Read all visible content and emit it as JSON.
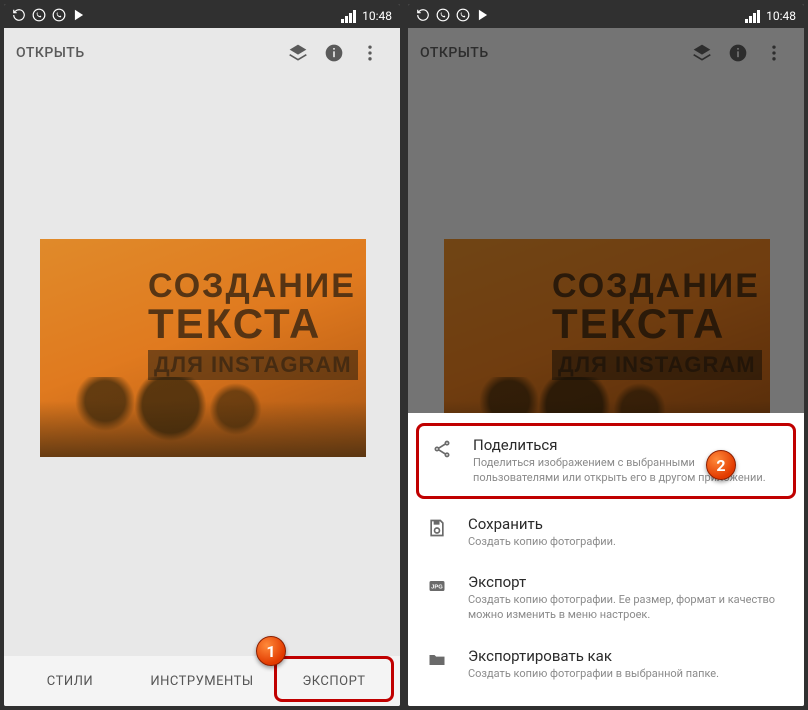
{
  "status": {
    "time": "10:48"
  },
  "app_bar": {
    "title": "ОТКРЫТЬ",
    "icons": {
      "layers": "layers-icon",
      "info": "info-icon",
      "overflow": "overflow-icon"
    }
  },
  "image_text": {
    "line1": "СОЗДАНИЕ",
    "line2": "ТЕКСТА",
    "line3": "ДЛЯ INSTAGRAM"
  },
  "tabs": {
    "styles": "СТИЛИ",
    "tools": "ИНСТРУМЕНТЫ",
    "export": "ЭКСПОРТ"
  },
  "sheet": {
    "share": {
      "title": "Поделиться",
      "desc": "Поделиться изображением с выбранными пользователями или открыть его в другом приложении."
    },
    "save": {
      "title": "Сохранить",
      "desc": "Создать копию фотографии."
    },
    "export": {
      "title": "Экспорт",
      "desc": "Создать копию фотографии. Ее размер, формат и качество можно изменить в меню настроек."
    },
    "export_as": {
      "title": "Экспортировать как",
      "desc": "Создать копию фотографии в выбранной папке."
    }
  },
  "callouts": {
    "one": "1",
    "two": "2"
  }
}
